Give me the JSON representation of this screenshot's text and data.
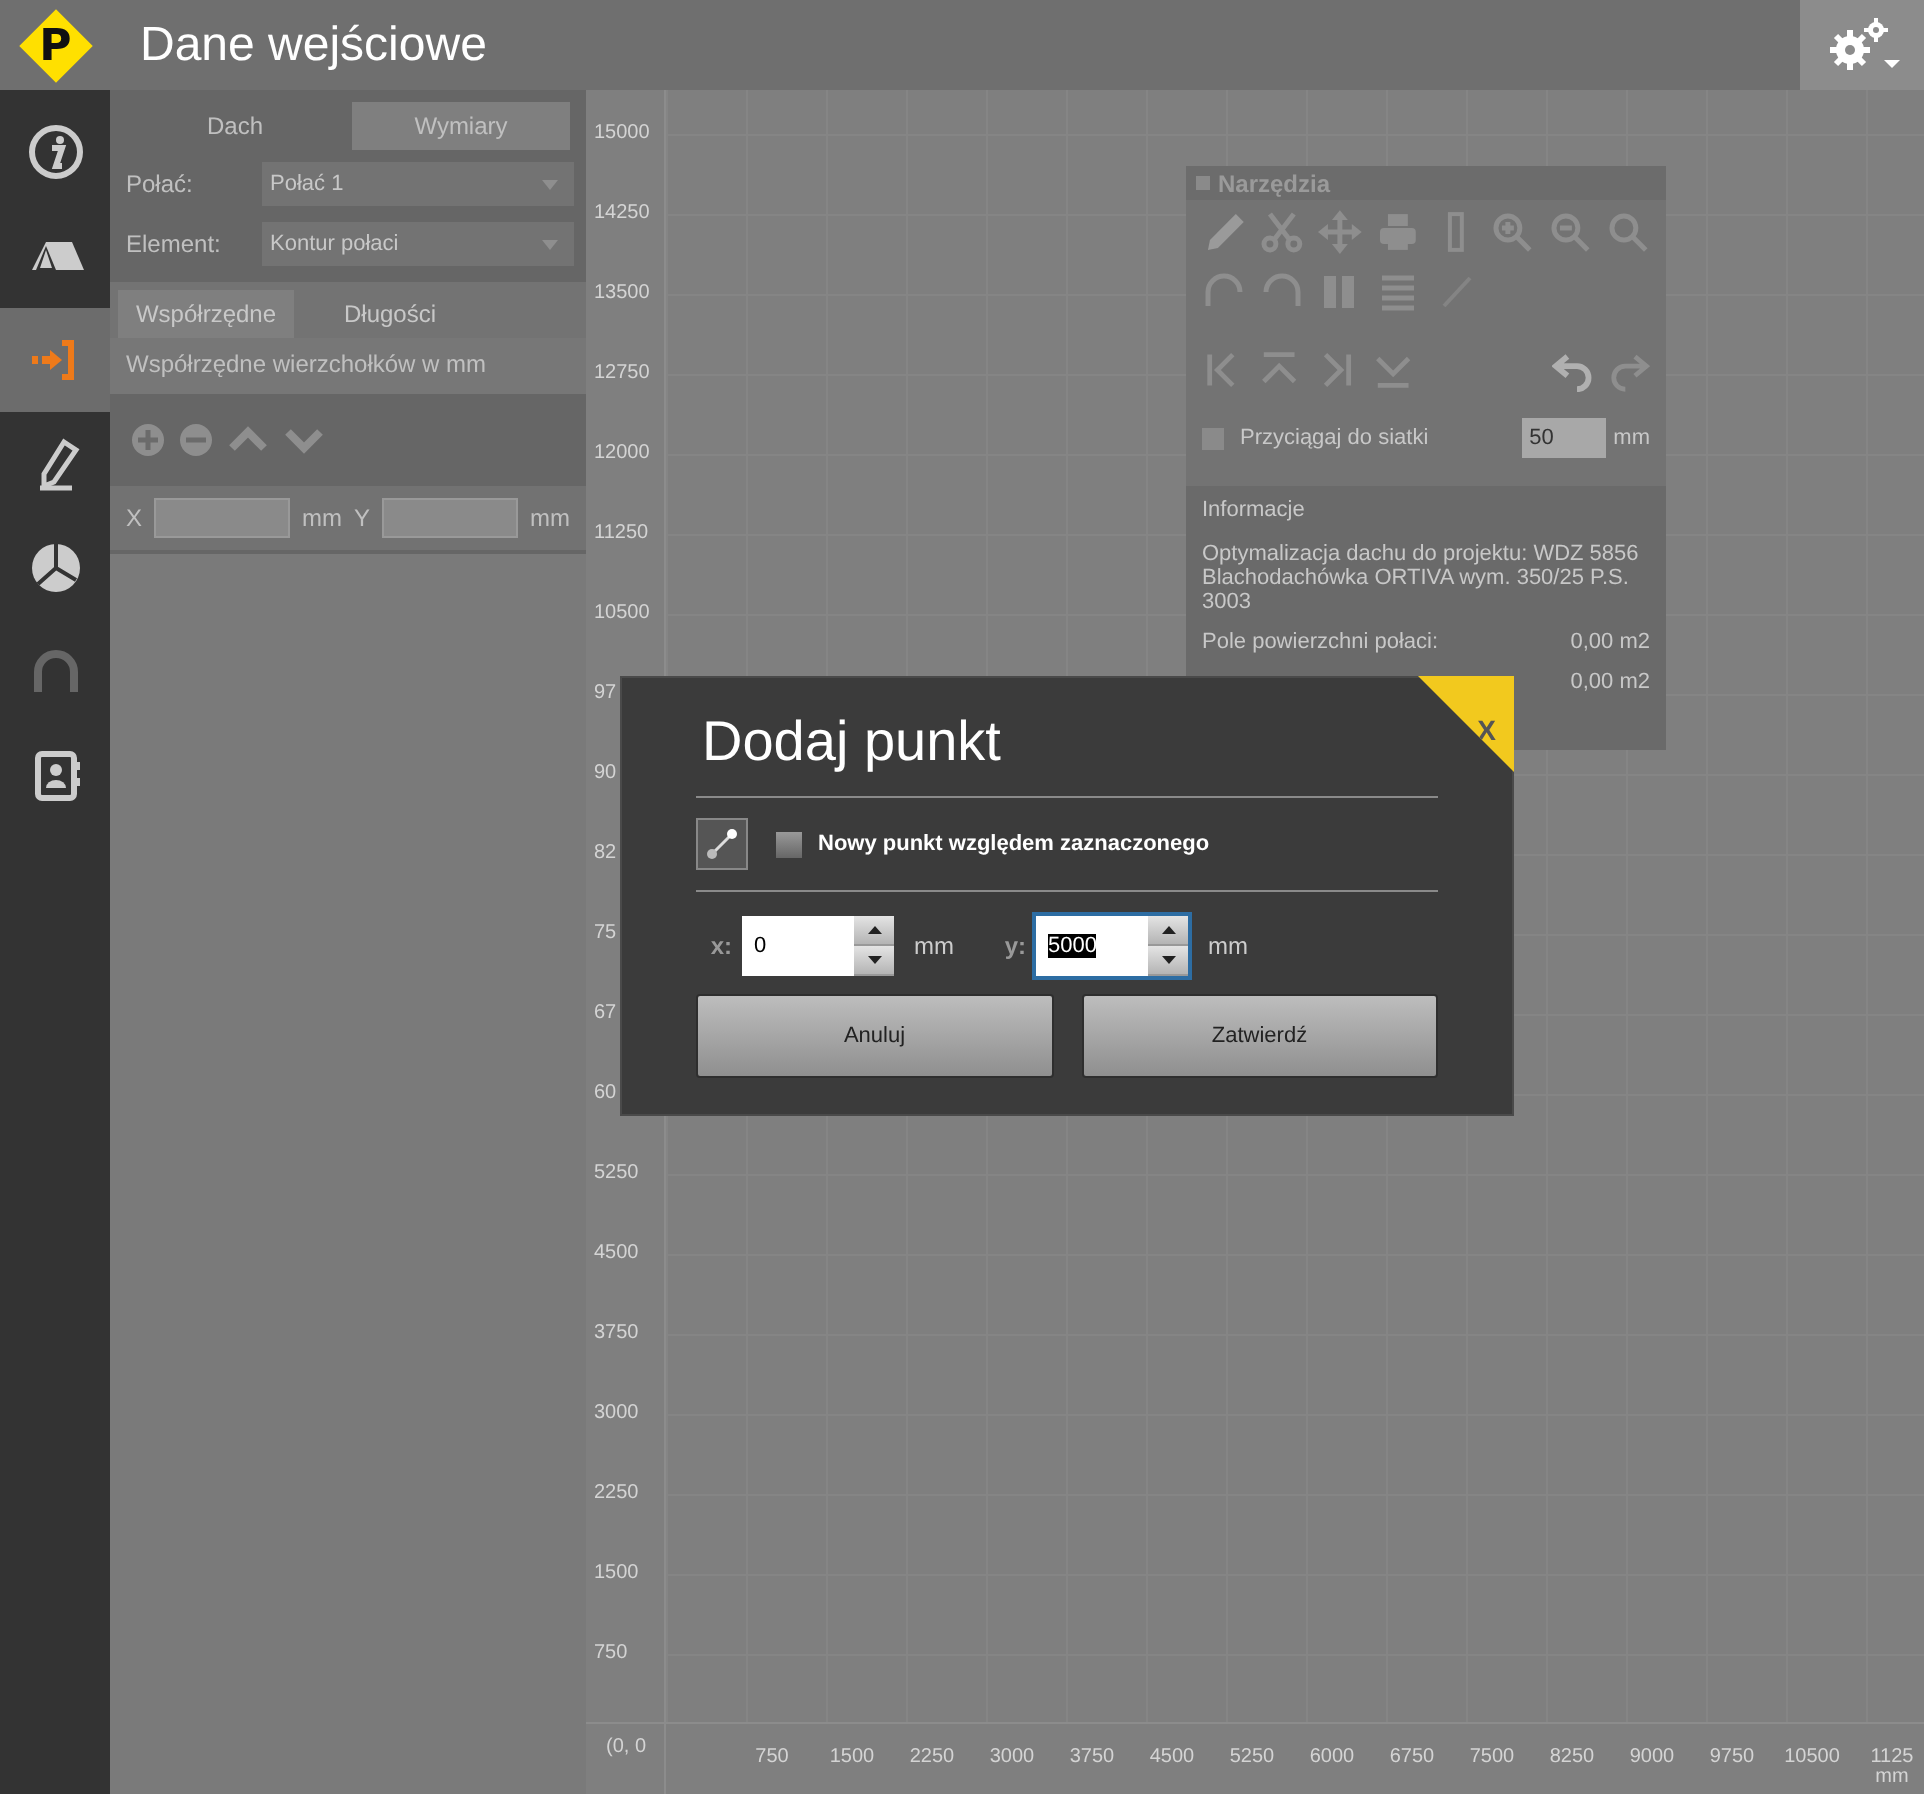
{
  "app_bar": {
    "logo": "P",
    "title": "Dane wejściowe"
  },
  "sidebar": {
    "items": [
      {
        "selected": false
      },
      {
        "selected": false
      },
      {
        "selected": true
      },
      {
        "selected": false
      },
      {
        "selected": false
      },
      {
        "selected": false
      },
      {
        "selected": false
      }
    ]
  },
  "left_panel": {
    "tabs": [
      {
        "label": "Dach",
        "selected": false
      },
      {
        "label": "Wymiary",
        "selected": true
      }
    ],
    "fields": [
      {
        "label": "Połać:",
        "value": "Połać 1"
      },
      {
        "label": "Element:",
        "value": "Kontur połaci"
      }
    ],
    "subtabs": [
      {
        "label": "Współrzędne",
        "selected": true
      },
      {
        "label": "Długości",
        "selected": false
      }
    ],
    "section_title": "Współrzędne wierzchołków w mm",
    "coords": [
      {
        "label": "X",
        "unit": "mm"
      },
      {
        "label": "Y",
        "unit": "mm"
      }
    ]
  },
  "canvas": {
    "y_ruler": [
      "15000",
      "14250",
      "13500",
      "12750",
      "12000",
      "11250",
      "10500",
      "97",
      "90",
      "82",
      "75",
      "67",
      "60",
      "5250",
      "4500",
      "3750",
      "3000",
      "2250",
      "1500",
      "750"
    ],
    "origin": "(0, 0",
    "x_ruler": [
      "750",
      "1500",
      "2250",
      "3000",
      "3750",
      "4500",
      "5250",
      "6000",
      "6750",
      "7500",
      "8250",
      "9000",
      "9750",
      "10500",
      "1125"
    ],
    "x_unit": "mm"
  },
  "tools_panel": {
    "title": "Narzędzia",
    "snap": {
      "label": "Przyciągaj do siatki",
      "checked": false,
      "value": "50",
      "unit": "mm"
    },
    "info": {
      "title": "Informacje",
      "lines": [
        "Optymalizacja dachu do projektu: WDZ 5856",
        "Blachodachówka ORTIVA wym. 350/25 P.S. 3003"
      ],
      "rows": [
        {
          "label": "Pole powierzchni połaci:",
          "value": "0,00 m2"
        },
        {
          "value": "0,00 m2"
        }
      ]
    }
  },
  "dialog": {
    "title": "Dodaj punkt",
    "close": "X",
    "relative": {
      "label": "Nowy punkt względem zaznaczonego",
      "checked": false
    },
    "inputs": [
      {
        "label": "x:",
        "value": "0",
        "unit": "mm",
        "focused": false
      },
      {
        "label": "y:",
        "value": "5000",
        "unit": "mm",
        "focused": true
      }
    ],
    "buttons": [
      "Anuluj",
      "Zatwierdź"
    ]
  }
}
